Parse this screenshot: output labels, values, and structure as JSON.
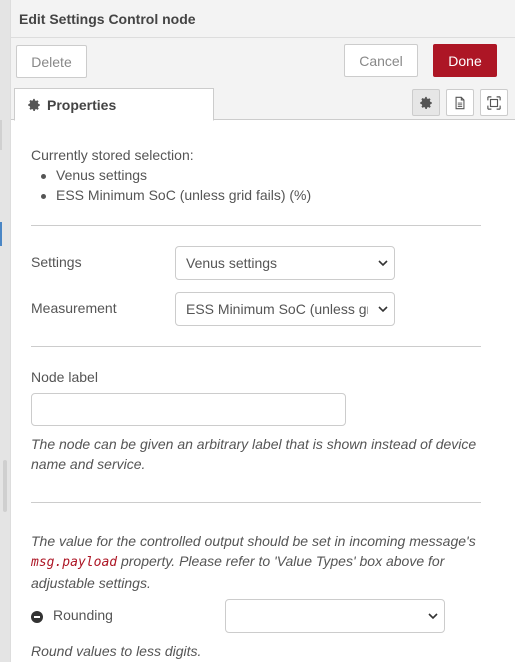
{
  "header": {
    "title": "Edit Settings Control node"
  },
  "toolbar": {
    "delete_label": "Delete",
    "cancel_label": "Cancel",
    "done_label": "Done"
  },
  "tabs": [
    {
      "label": "Properties",
      "icon": "gear-icon"
    }
  ],
  "tab_buttons": [
    {
      "icon": "gear-icon",
      "active": true
    },
    {
      "icon": "document-icon",
      "active": false
    },
    {
      "icon": "appearance-icon",
      "active": false
    }
  ],
  "stored": {
    "heading": "Currently stored selection:",
    "items": [
      "Venus settings",
      "ESS Minimum SoC (unless grid fails) (%)"
    ]
  },
  "settings": {
    "label": "Settings",
    "value": "Venus settings"
  },
  "measurement": {
    "label": "Measurement",
    "value": "ESS Minimum SoC (unless grid fails) (%)"
  },
  "node_label": {
    "label": "Node label",
    "value": "",
    "help": "The node can be given an arbitrary label that is shown instead of device name and service."
  },
  "value_info": {
    "part1": "The value for the controlled output should be set in incoming message's",
    "code": "msg.payload",
    "part2": " property. Please refer to 'Value Types' box above for adjustable settings."
  },
  "rounding": {
    "label": "Rounding",
    "value": "",
    "help": "Round values to less digits."
  },
  "colors": {
    "accent": "#ad1625",
    "panel_bg": "#f3f3f3",
    "border": "#cccccc"
  }
}
